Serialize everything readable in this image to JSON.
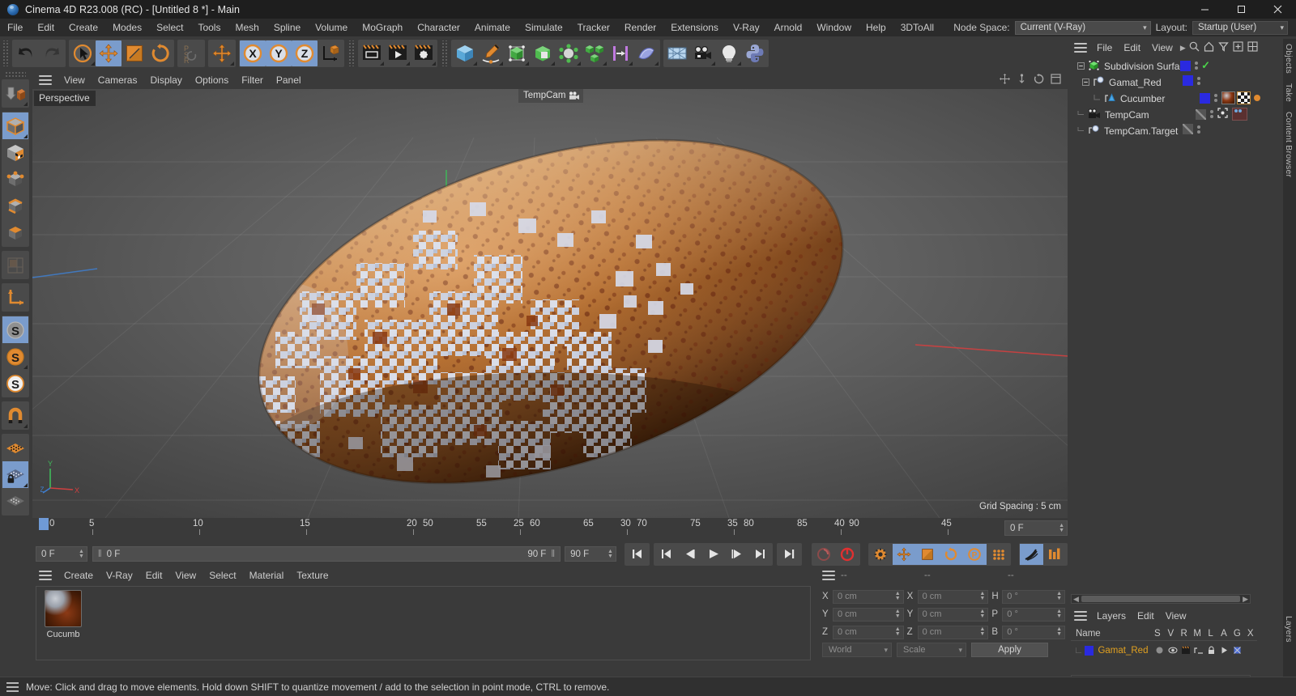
{
  "window": {
    "title": "Cinema 4D R23.008 (RC) - [Untitled 8 *] - Main",
    "logo": "cinema4d-logo",
    "minimize": "minimize-icon",
    "maximize": "maximize-icon",
    "close": "close-icon"
  },
  "menubar": {
    "items": [
      "File",
      "Edit",
      "Create",
      "Modes",
      "Select",
      "Tools",
      "Mesh",
      "Spline",
      "Volume",
      "MoGraph",
      "Character",
      "Animate",
      "Simulate",
      "Tracker",
      "Render",
      "Extensions",
      "V-Ray",
      "Arnold",
      "Window",
      "Help",
      "3DToAll"
    ],
    "node_space_label": "Node Space:",
    "node_space_value": "Current (V-Ray)",
    "layout_label": "Layout:",
    "layout_value": "Startup (User)"
  },
  "toolbar": {
    "items": [
      {
        "name": "undo-icon",
        "label": "Undo",
        "active": false
      },
      {
        "name": "redo-icon",
        "label": "Redo",
        "active": false
      },
      {
        "name": "selection-tool-icon",
        "label": "Live Selection",
        "active": false
      },
      {
        "name": "move-tool-icon",
        "label": "Move",
        "active": true
      },
      {
        "name": "scale-tool-icon",
        "label": "Scale",
        "active": false
      },
      {
        "name": "rotate-tool-icon",
        "label": "Rotate",
        "active": false
      },
      {
        "name": "psr-lock-icon",
        "label": "PSR",
        "active": false
      },
      {
        "name": "world-object-axis-icon",
        "label": "World/Object Axis",
        "active": false
      },
      {
        "name": "x-axis-icon",
        "label": "X",
        "active": true
      },
      {
        "name": "y-axis-icon",
        "label": "Y",
        "active": true
      },
      {
        "name": "z-axis-icon",
        "label": "Z",
        "active": true
      },
      {
        "name": "coordinate-system-icon",
        "label": "Coordinate System",
        "active": false
      },
      {
        "name": "render-view-icon",
        "label": "Render View",
        "active": false
      },
      {
        "name": "render-queue-icon",
        "label": "Render to Picture Viewer",
        "active": false
      },
      {
        "name": "render-settings-icon",
        "label": "Edit Render Settings",
        "active": false
      },
      {
        "name": "cube-primitive-icon",
        "label": "Add Cube Object",
        "active": false
      },
      {
        "name": "spline-pen-icon",
        "label": "Spline Pen",
        "active": false
      },
      {
        "name": "nurbs-icon",
        "label": "Subdivision Surface",
        "active": false
      },
      {
        "name": "array-icon",
        "label": "Array Object",
        "active": false
      },
      {
        "name": "scene-nodes-icon",
        "label": "Scene Nodes",
        "active": false
      },
      {
        "name": "cloner-icon",
        "label": "MoGraph Cloner",
        "active": false
      },
      {
        "name": "deformer-icon",
        "label": "Bend Deformer",
        "active": false
      },
      {
        "name": "field-icon",
        "label": "Linear Field",
        "active": false
      },
      {
        "name": "floor-icon",
        "label": "Floor Object",
        "active": false
      },
      {
        "name": "camera-icon",
        "label": "Camera",
        "active": false
      },
      {
        "name": "light-icon",
        "label": "Light",
        "active": false
      },
      {
        "name": "python-icon",
        "label": "Python Generator",
        "active": false
      }
    ]
  },
  "left_toolbar": {
    "items": [
      {
        "name": "make-editable-icon",
        "label": "Make Editable",
        "active": false
      },
      {
        "name": "model-mode-icon",
        "label": "Model Mode",
        "active": true
      },
      {
        "name": "texture-mode-icon",
        "label": "Texture Mode",
        "active": false
      },
      {
        "name": "point-mode-icon",
        "label": "Points",
        "active": false
      },
      {
        "name": "edge-mode-icon",
        "label": "Edges",
        "active": false
      },
      {
        "name": "polygon-mode-icon",
        "label": "Polygons",
        "active": false
      },
      {
        "name": "uv-mode-icon",
        "label": "UV Mesh",
        "active": false
      },
      {
        "name": "axis-mode-icon",
        "label": "Enable Axis",
        "active": false
      },
      {
        "name": "snap-enable-icon",
        "label": "Enable Snapping",
        "active": true
      },
      {
        "name": "snap-2d-icon",
        "label": "2D Snapping",
        "active": false
      },
      {
        "name": "snap-3d-icon",
        "label": "3D Snapping",
        "active": false
      },
      {
        "name": "magnet-icon",
        "label": "Magnet",
        "active": false
      },
      {
        "name": "workplane-icon",
        "label": "Workplane",
        "active": false
      },
      {
        "name": "workplane-lock-icon",
        "label": "Lock Workplane",
        "active": true
      },
      {
        "name": "workplane-planar-icon",
        "label": "Planar Workplane",
        "active": false
      }
    ]
  },
  "viewport": {
    "menu_items": [
      "View",
      "Cameras",
      "Display",
      "Options",
      "Filter",
      "Panel"
    ],
    "perspective_label": "Perspective",
    "camera_tag": "TempCam",
    "camera_tag_icon": "camera-icon",
    "grid_spacing": "Grid Spacing : 5 cm",
    "axis": {
      "x": "X",
      "y": "Y",
      "z": "Z"
    },
    "corner_icons": [
      "move-view-icon",
      "scale-view-icon",
      "rotate-view-icon",
      "maximize-view-icon"
    ]
  },
  "timeline": {
    "ticks": [
      0,
      5,
      10,
      15,
      20,
      25,
      30,
      35,
      40,
      45,
      50,
      55,
      60,
      65,
      70,
      75,
      80,
      85,
      90
    ],
    "current_frame": "0 F",
    "playhead_frame": 0
  },
  "transport": {
    "start_field": "0 F",
    "preview_min": "0 F",
    "preview_max": "90 F",
    "end_field": "90 F",
    "buttons": [
      {
        "name": "go-to-start-button",
        "label": "Go to Start",
        "active": false
      },
      {
        "name": "go-to-previous-key-button",
        "label": "Go to Previous Key",
        "active": false
      },
      {
        "name": "step-back-button",
        "label": "Go to Previous Frame",
        "active": false
      },
      {
        "name": "play-button",
        "label": "Play Forwards",
        "active": false
      },
      {
        "name": "step-forward-button",
        "label": "Go to Next Frame",
        "active": false
      },
      {
        "name": "go-to-next-key-button",
        "label": "Go to Next Key",
        "active": false
      },
      {
        "name": "go-to-end-button",
        "label": "Go to End",
        "active": false
      },
      {
        "name": "record-active-objects-button",
        "label": "Record Active Objects",
        "active": false
      },
      {
        "name": "autokeying-button",
        "label": "Autokeying",
        "active": false
      },
      {
        "name": "keyframe-selection-button",
        "label": "Keyframe Selection",
        "active": false
      },
      {
        "name": "position-key-button",
        "label": "Position",
        "active": true
      },
      {
        "name": "scale-key-button",
        "label": "Scale",
        "active": true
      },
      {
        "name": "rotation-key-button",
        "label": "Rotation",
        "active": true
      },
      {
        "name": "param-key-button",
        "label": "Parameter",
        "active": true
      },
      {
        "name": "pla-key-button",
        "label": "Point Level Animation",
        "active": false
      },
      {
        "name": "dynamics-button",
        "label": "Dynamics",
        "active": false
      },
      {
        "name": "project-settings-button",
        "label": "Project Settings",
        "active": false
      }
    ]
  },
  "material_manager": {
    "menu_items": [
      "Create",
      "V-Ray",
      "Edit",
      "View",
      "Select",
      "Material",
      "Texture"
    ],
    "materials": [
      {
        "name": "Cucumb",
        "thumb": "material-preview"
      }
    ]
  },
  "coordinates": {
    "header": [
      "--",
      "--",
      "--"
    ],
    "rows": [
      {
        "l1": "X",
        "v1": "0 cm",
        "l2": "X",
        "v2": "0 cm",
        "l3": "H",
        "v3": "0 °"
      },
      {
        "l1": "Y",
        "v1": "0 cm",
        "l2": "Y",
        "v2": "0 cm",
        "l3": "P",
        "v3": "0 °"
      },
      {
        "l1": "Z",
        "v1": "0 cm",
        "l2": "Z",
        "v2": "0 cm",
        "l3": "B",
        "v3": "0 °"
      }
    ],
    "system": "World",
    "mode": "Scale",
    "apply": "Apply"
  },
  "object_manager": {
    "menu_items": [
      "File",
      "Edit",
      "View"
    ],
    "icons": [
      "search-icon",
      "home-icon",
      "filter-icon",
      "add-icon",
      "grid-icon"
    ],
    "rows": [
      {
        "name": "Subdivision Surface",
        "indent": 0,
        "icon": "subdivision-surface-icon",
        "color": "#2a2ae0",
        "check": true,
        "tags": []
      },
      {
        "name": "Gamat_Red",
        "indent": 1,
        "icon": "null-object-icon",
        "color": "#2a2ae0",
        "check": false,
        "tags": []
      },
      {
        "name": "Cucumber",
        "indent": 2,
        "icon": "polygon-object-icon",
        "color": "#2a2ae0",
        "check": false,
        "tags": [
          "material-tag",
          "texture-tag",
          "dot-tag"
        ]
      },
      {
        "name": "TempCam",
        "indent": 0,
        "icon": "camera-object-icon",
        "color": "#545454",
        "check": false,
        "tags": [
          "camera-tag"
        ]
      },
      {
        "name": "TempCam.Target",
        "indent": 0,
        "icon": "null-object-icon",
        "color": "#545454",
        "check": false,
        "tags": []
      }
    ]
  },
  "layers": {
    "menu_items": [
      "Layers",
      "Edit",
      "View"
    ],
    "columns": [
      "Name",
      "S",
      "V",
      "R",
      "M",
      "L",
      "A",
      "G",
      "X"
    ],
    "rows": [
      {
        "name": "Gamat_Red",
        "color": "#2a2ae0"
      }
    ]
  },
  "edge_tabs": [
    "Objects",
    "Take",
    "Content Browser",
    "Layers"
  ],
  "statusbar": {
    "text": "Move: Click and drag to move elements. Hold down SHIFT to quantize movement / add to the selection in point mode, CTRL to remove.",
    "icon": "menu-icon"
  },
  "colors": {
    "accent_blue": "#7a9ccc",
    "orange": "#e08a30",
    "green": "#4bbf4b",
    "object_blue": "#2a2ae0",
    "panel_bg": "#3a3a3a",
    "dark_bg": "#2b2b2b"
  }
}
